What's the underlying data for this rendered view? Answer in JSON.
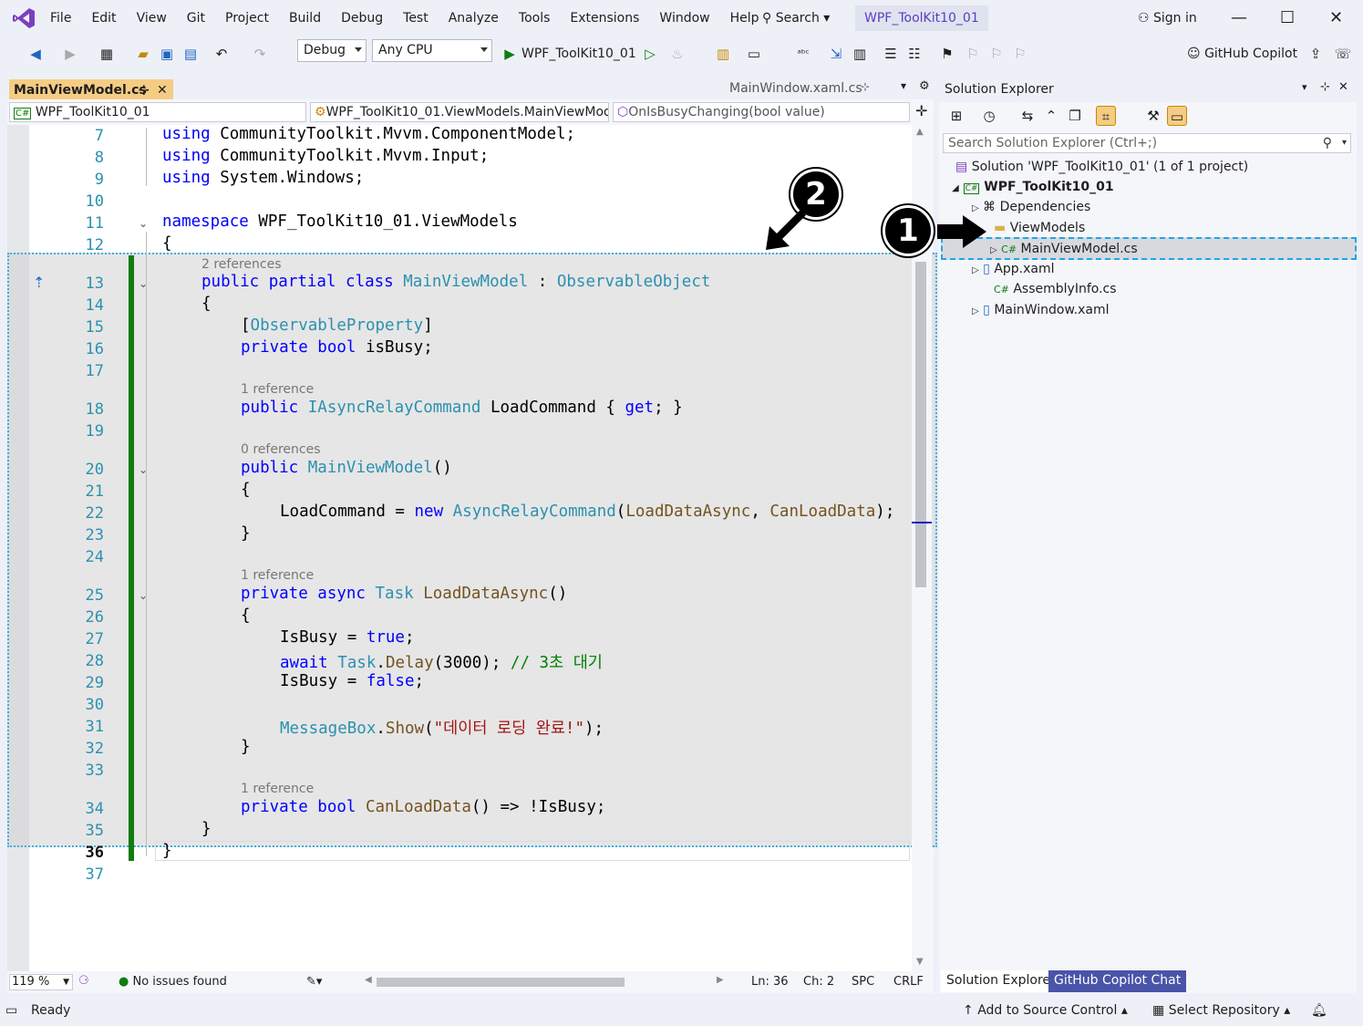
{
  "app": {
    "logo": "visual-studio-logo",
    "project_tab": "WPF_ToolKit10_01",
    "sign_in": "Sign in",
    "copilot": "GitHub Copilot",
    "search": "Search"
  },
  "menu": [
    "File",
    "Edit",
    "View",
    "Git",
    "Project",
    "Build",
    "Debug",
    "Test",
    "Analyze",
    "Tools",
    "Extensions",
    "Window",
    "Help"
  ],
  "toolbar": {
    "config": "Debug",
    "platform": "Any CPU",
    "run_target": "WPF_ToolKit10_01"
  },
  "editor": {
    "active_tab": "MainViewModel.cs",
    "other_tab": "MainWindow.xaml.cs",
    "nav_project": "WPF_ToolKit10_01",
    "nav_class": "WPF_ToolKit10_01.ViewModels.MainViewMod",
    "nav_member": "OnIsBusyChanging(bool value)",
    "lines": [
      "7",
      "8",
      "9",
      "10",
      "11",
      "12",
      "13",
      "14",
      "15",
      "16",
      "17",
      "18",
      "19",
      "20",
      "21",
      "22",
      "23",
      "24",
      "25",
      "26",
      "27",
      "28",
      "29",
      "30",
      "31",
      "32",
      "33",
      "34",
      "35",
      "36",
      "37"
    ],
    "refs": {
      "r13": "2 references",
      "r18": "1 reference",
      "r20": "0 references",
      "r25": "1 reference",
      "r34": "1 reference"
    },
    "code": {
      "l7": [
        "using",
        " CommunityToolkit.Mvvm.ComponentModel;"
      ],
      "l8": [
        "using",
        " CommunityToolkit.Mvvm.Input;"
      ],
      "l9": [
        "using",
        " System.Windows;"
      ],
      "l11": [
        "namespace",
        " WPF_ToolKit10_01.ViewModels"
      ],
      "l12": "{",
      "l13": [
        "public partial class",
        " ",
        "MainViewModel",
        " : ",
        "ObservableObject"
      ],
      "l14": "{",
      "l15": [
        "[",
        "ObservableProperty",
        "]"
      ],
      "l16": [
        "private bool",
        " isBusy;"
      ],
      "l18": [
        "public",
        " ",
        "IAsyncRelayCommand",
        " LoadCommand { ",
        "get",
        "; }"
      ],
      "l20": [
        "public",
        " ",
        "MainViewModel",
        "()"
      ],
      "l21": "{",
      "l22": [
        "LoadCommand = ",
        "new",
        " ",
        "AsyncRelayCommand",
        "(",
        "LoadDataAsync",
        ", ",
        "CanLoadData",
        ");"
      ],
      "l23": "}",
      "l25": [
        "private async",
        " ",
        "Task",
        " ",
        "LoadDataAsync",
        "()"
      ],
      "l26": "{",
      "l27": [
        "IsBusy = ",
        "true",
        ";"
      ],
      "l28": [
        "await",
        " ",
        "Task",
        ".",
        "Delay",
        "(3000); ",
        "// 3초 대기"
      ],
      "l29": [
        "IsBusy = ",
        "false",
        ";"
      ],
      "l31": [
        "MessageBox",
        ".",
        "Show",
        "(",
        "\"데이터 로딩 완료!\"",
        ");"
      ],
      "l32": "}",
      "l34": [
        "private bool",
        " ",
        "CanLoadData",
        "() => !IsBusy;"
      ],
      "l35": "}",
      "l36": "}"
    },
    "zoom": "119 %",
    "issues": "No issues found",
    "ln": "Ln: 36",
    "ch": "Ch: 2",
    "spc": "SPC",
    "crlf": "CRLF"
  },
  "solution_explorer": {
    "title": "Solution Explorer",
    "search_placeholder": "Search Solution Explorer (Ctrl+;)",
    "solution": "Solution 'WPF_ToolKit10_01' (1 of 1 project)",
    "project": "WPF_ToolKit10_01",
    "dependencies": "Dependencies",
    "folder": "ViewModels",
    "file_vm": "MainViewModel.cs",
    "app_xaml": "App.xaml",
    "assembly": "AssemblyInfo.cs",
    "mainwindow": "MainWindow.xaml",
    "cs_badge": "C#",
    "tab1": "Solution Explorer",
    "tab2": "GitHub Copilot Chat"
  },
  "status": {
    "ready": "Ready",
    "add_source": "Add to Source Control",
    "select_repo": "Select Repository"
  },
  "annotations": {
    "badge1": "1",
    "badge2": "2"
  }
}
